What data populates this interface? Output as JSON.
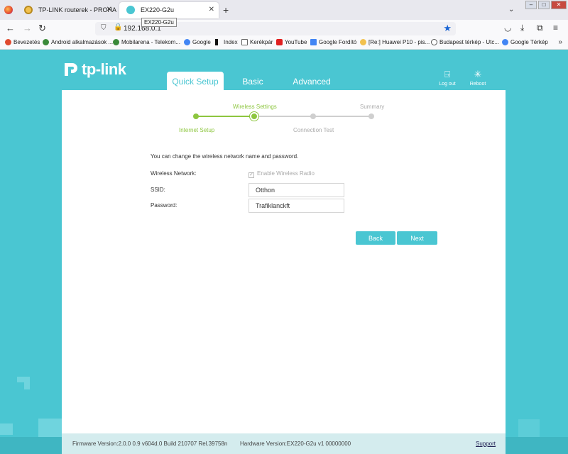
{
  "browser": {
    "tabs": [
      {
        "title": "TP-LINK routerek - PROHARDV",
        "active": false
      },
      {
        "title": "EX220-G2u",
        "active": true
      }
    ],
    "tooltip": "EX220-G2u",
    "url": "192.168.0.1",
    "bookmarks": [
      {
        "label": "Bevezetés",
        "color": "#e04a2f"
      },
      {
        "label": "Android alkalmazások ...",
        "color": "#3a8a3a"
      },
      {
        "label": "Mobilarena - Telekom...",
        "color": "#3a8a3a"
      },
      {
        "label": "Google",
        "color": "#4285f4"
      },
      {
        "label": "Index",
        "color": "#111111"
      },
      {
        "label": "Kerékpár",
        "color": "#666666"
      },
      {
        "label": "YouTube",
        "color": "#e02020"
      },
      {
        "label": "Google Fordító",
        "color": "#4285f4"
      },
      {
        "label": "[Re:] Huawei P10 - pis...",
        "color": "#f2c14e"
      },
      {
        "label": "Budapest térkép - Utc...",
        "color": "#555555"
      },
      {
        "label": "Google Térkép",
        "color": "#4285f4"
      }
    ]
  },
  "router": {
    "logo": "tp-link",
    "tabs": [
      "Quick Setup",
      "Basic",
      "Advanced"
    ],
    "logout_label": "Log out",
    "reboot_label": "Reboot",
    "steps": {
      "internet_setup": "Internet Setup",
      "wireless_settings": "Wireless Settings",
      "connection_test": "Connection Test",
      "summary": "Summary"
    },
    "intro": "You can change the wireless network name and password.",
    "wireless_network_label": "Wireless Network:",
    "enable_radio_label": "Enable Wireless Radio",
    "ssid_label": "SSID:",
    "ssid_value": "Otthon",
    "password_label": "Password:",
    "password_value": "Trafiklanckft",
    "back_label": "Back",
    "next_label": "Next",
    "firmware": "Firmware Version:2.0.0 0.9 v604d.0 Build 210707 Rel.39758n",
    "hardware": "Hardware Version:EX220-G2u v1 00000000",
    "support": "Support",
    "accent_color": "#4ac6d2",
    "progress_color": "#8dc63f"
  }
}
